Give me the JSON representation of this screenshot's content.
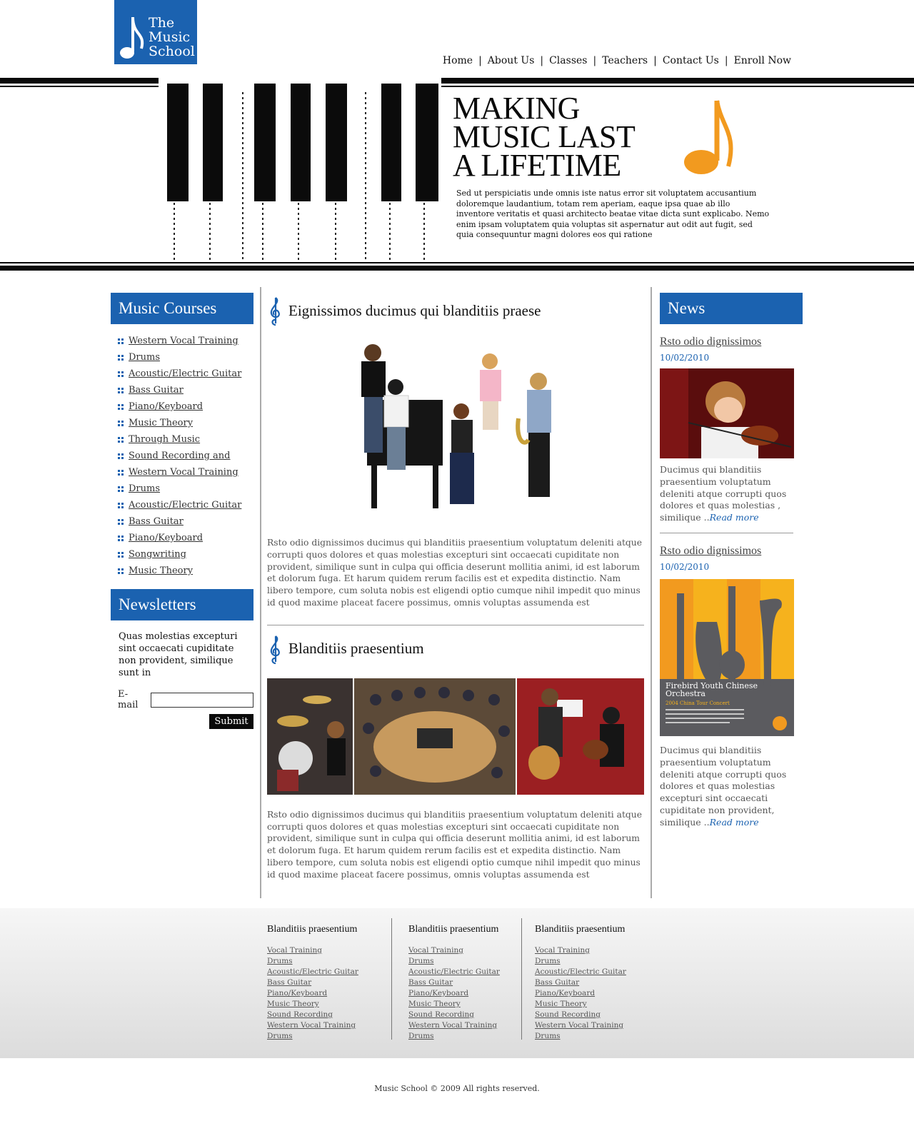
{
  "header": {
    "logo_lines": [
      "The",
      "Music",
      "School"
    ],
    "nav": [
      "Home",
      "About Us",
      "Classes",
      "Teachers",
      "Contact Us",
      "Enroll Now"
    ],
    "nav_separator": "|"
  },
  "banner": {
    "title_lines": [
      "MAKING",
      "MUSIC LAST",
      "A LIFETIME"
    ],
    "text": "Sed ut perspiciatis unde omnis iste natus error sit voluptatem accusantium doloremque laudantium, totam rem aperiam, eaque ipsa quae ab illo inventore veritatis et quasi architecto beatae vitae dicta sunt explicabo. Nemo enim ipsam voluptatem quia voluptas sit aspernatur aut odit aut fugit, sed quia consequuntur magni dolores eos qui ratione"
  },
  "courses": {
    "title": "Music Courses",
    "items": [
      "Western Vocal Training",
      "Drums",
      "Acoustic/Electric Guitar",
      "Bass Guitar",
      "Piano/Keyboard",
      "Music Theory",
      "Through Music",
      "Sound Recording and",
      "Western Vocal Training",
      "Drums",
      "Acoustic/Electric Guitar",
      "Bass Guitar",
      "Piano/Keyboard",
      "Songwriting",
      "Music Theory"
    ]
  },
  "newsletter": {
    "title": "Newsletters",
    "text": "Quas molestias excepturi sint occaecati cupiditate non provident, similique sunt in",
    "email_label": "E-mail",
    "submit_label": "Submit"
  },
  "main": {
    "section1": {
      "title": "Eignissimos ducimus qui blanditiis praese",
      "text": "Rsto odio dignissimos ducimus qui blanditiis praesentium voluptatum deleniti atque corrupti quos dolores et quas molestias excepturi sint occaecati cupiditate non provident, similique sunt in culpa qui officia deserunt mollitia animi, id est laborum et dolorum fuga. Et harum quidem rerum facilis est et expedita distinctio. Nam libero tempore, cum soluta nobis est eligendi optio cumque nihil impedit quo minus id quod maxime placeat facere possimus, omnis voluptas assumenda est"
    },
    "section2": {
      "title": "Blanditiis praesentium",
      "text": "Rsto odio dignissimos ducimus qui blanditiis praesentium voluptatum deleniti atque corrupti quos dolores et quas molestias excepturi sint occaecati cupiditate non provident, similique sunt in culpa qui officia deserunt mollitia animi, id est laborum et dolorum fuga. Et harum quidem rerum facilis est et expedita distinctio. Nam libero tempore, cum soluta nobis est eligendi optio cumque nihil impedit quo minus id quod maxime placeat facere possimus, omnis voluptas assumenda est"
    }
  },
  "news": {
    "title": "News",
    "items": [
      {
        "title": "Rsto odio dignissimos",
        "date": "10/02/2010",
        "text": "Ducimus qui blanditiis praesentium voluptatum deleniti atque corrupti quos dolores et quas molestias , similique ..",
        "read_more": "Read more"
      },
      {
        "title": "Rsto odio dignissimos",
        "date": "10/02/2010",
        "text": "Ducimus qui blanditiis praesentium voluptatum deleniti atque corrupti quos dolores et quas molestias excepturi sint occaecati cupiditate non provident, similique ..",
        "read_more": "Read more",
        "poster_title": "Firebird Youth Chinese Orchestra",
        "poster_subtitle": "2004 China Tour Concert"
      }
    ]
  },
  "footer": {
    "columns": [
      {
        "title": "Blanditiis praesentium",
        "links": [
          "Vocal Training",
          "Drums",
          "Acoustic/Electric Guitar",
          "Bass Guitar",
          "Piano/Keyboard",
          "Music Theory",
          "Sound Recording",
          "Western Vocal Training",
          "Drums"
        ]
      },
      {
        "title": "Blanditiis praesentium",
        "links": [
          "Vocal Training",
          "Drums",
          "Acoustic/Electric Guitar",
          "Bass Guitar",
          "Piano/Keyboard",
          "Music Theory",
          "Sound Recording",
          "Western Vocal Training",
          "Drums"
        ]
      },
      {
        "title": "Blanditiis praesentium",
        "links": [
          "Vocal Training",
          "Drums",
          "Acoustic/Electric Guitar",
          "Bass Guitar",
          "Piano/Keyboard",
          "Music Theory",
          "Sound Recording",
          "Western Vocal Training",
          "Drums"
        ]
      }
    ],
    "copyright": "Music School © 2009 All rights reserved."
  },
  "colors": {
    "brand_blue": "#1b62b0",
    "accent_orange": "#f29a1f",
    "text_gray": "#555555"
  }
}
